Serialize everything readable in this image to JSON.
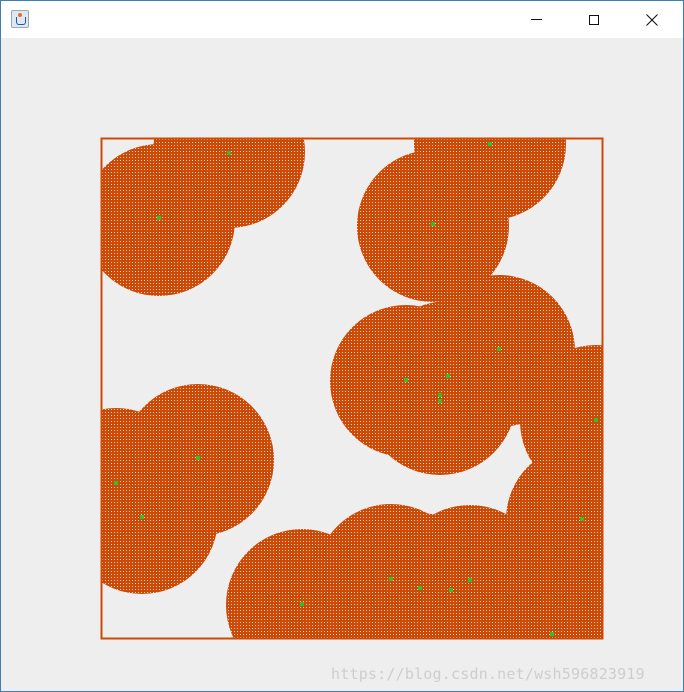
{
  "window": {
    "controls": {
      "minimize_icon": "minimize-icon",
      "maximize_icon": "maximize-icon",
      "close_icon": "close-icon"
    },
    "app_icon": "java-cup-icon"
  },
  "canvas": {
    "fill_color": "#cc4a06",
    "grid_color": "#f0d2c0",
    "frame_color": "#cc4a06",
    "point_color": "#2fc02f",
    "point_count": 24
  },
  "watermark": {
    "text": "https://blog.csdn.net/wsh596823919"
  }
}
